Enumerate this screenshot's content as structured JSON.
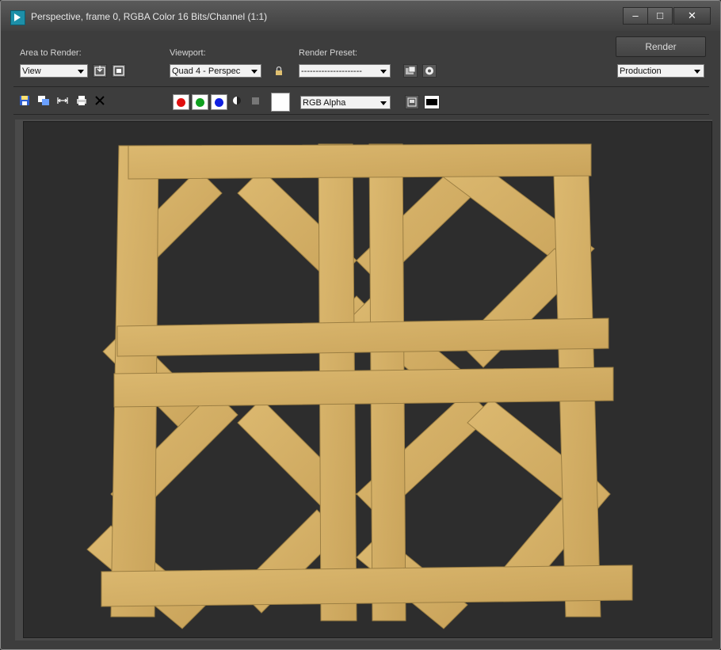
{
  "window": {
    "title": "Perspective, frame 0, RGBA Color 16 Bits/Channel (1:1)",
    "controls": {
      "minimize": "–",
      "maximize": "□",
      "close": "✕"
    }
  },
  "toolbar1": {
    "area_label": "Area to Render:",
    "area_value": "View",
    "viewport_label": "Viewport:",
    "viewport_value": "Quad 4 - Perspec",
    "preset_label": "Render Preset:",
    "preset_value": "---------------------",
    "render_button": "Render",
    "mode_value": "Production"
  },
  "toolbar2": {
    "channel_display_value": "RGB Alpha",
    "channel_colors": {
      "red": "#e01010",
      "green": "#10a020",
      "blue": "#1020e0"
    }
  },
  "render": {
    "background": "#2d2d2d",
    "material_color": "#d4b06a",
    "material_shadow": "#a88a4a"
  }
}
